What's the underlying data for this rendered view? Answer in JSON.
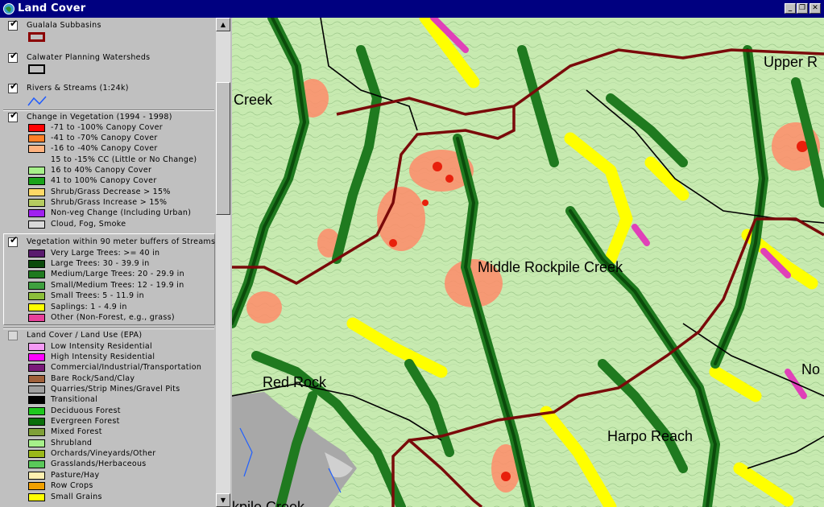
{
  "window": {
    "title": "Land Cover",
    "controls": {
      "minimize": "_",
      "restore": "❐",
      "close": "✕"
    }
  },
  "legend": {
    "layers": [
      {
        "name": "Gualala Subbasins",
        "checked": true,
        "swatch": "#8b0000"
      },
      {
        "name": "Calwater Planning Watersheds",
        "checked": true,
        "swatch": "#000000"
      },
      {
        "name": "Rivers & Streams (1:24k)",
        "checked": true,
        "swatch": "#1e5aff"
      },
      {
        "name": "Change in Vegetation (1994 - 1998)",
        "checked": true,
        "entries": [
          {
            "label": "-71 to -100% Canopy Cover",
            "color": "#ff0000"
          },
          {
            "label": "-41 to -70% Canopy Cover",
            "color": "#ff7f27"
          },
          {
            "label": "-16 to -40% Canopy Cover",
            "color": "#ffb27f"
          },
          {
            "label": "15 to -15% CC (Little or No Change)",
            "color": ""
          },
          {
            "label": "16 to 40% Canopy Cover",
            "color": "#a6f08a"
          },
          {
            "label": "41 to 100% Canopy Cover",
            "color": "#1aa31a"
          },
          {
            "label": "Shrub/Grass Decrease > 15%",
            "color": "#ffd966"
          },
          {
            "label": "Shrub/Grass Increase > 15%",
            "color": "#b5cc60"
          },
          {
            "label": "Non-veg Change (Including Urban)",
            "color": "#a020f0"
          },
          {
            "label": "Cloud, Fog, Smoke",
            "color": "#d9d9d9"
          }
        ]
      },
      {
        "name": "Vegetation within 90 meter buffers of Streams",
        "checked": true,
        "entries": [
          {
            "label": "Very Large Trees: >= 40  in",
            "color": "#5a1a6e"
          },
          {
            "label": "Large Trees: 30 - 39.9 in",
            "color": "#0b4a0b"
          },
          {
            "label": "Medium/Large Trees: 20 - 29.9 in",
            "color": "#1f7a1f"
          },
          {
            "label": "Small/Medium Trees: 12 - 19.9 in",
            "color": "#3fa03f"
          },
          {
            "label": "Small Trees: 5 - 11.9 in",
            "color": "#8cbf3a"
          },
          {
            "label": "Saplings: 1 - 4.9 in",
            "color": "#ffff00"
          },
          {
            "label": "Other (Non-Forest, e.g., grass)",
            "color": "#e8409a"
          }
        ]
      },
      {
        "name": "Land Cover / Land Use (EPA)",
        "checked": false,
        "entries": [
          {
            "label": "Low Intensity Residential",
            "color": "#f59af5"
          },
          {
            "label": "High Intensity Residential",
            "color": "#ff00ff"
          },
          {
            "label": "Commercial/Industrial/Transportation",
            "color": "#7a1a7a"
          },
          {
            "label": "Bare Rock/Sand/Clay",
            "color": "#a0603a"
          },
          {
            "label": "Quarries/Strip Mines/Gravel Pits",
            "color": "#a0a0a0"
          },
          {
            "label": "Transitional",
            "color": "#000000"
          },
          {
            "label": "Deciduous Forest",
            "color": "#1ec81e"
          },
          {
            "label": "Evergreen Forest",
            "color": "#0a6e0a"
          },
          {
            "label": "Mixed Forest",
            "color": "#7fa038"
          },
          {
            "label": "Shrubland",
            "color": "#a6f08a"
          },
          {
            "label": "Orchards/Vineyards/Other",
            "color": "#9ab81a"
          },
          {
            "label": "Grasslands/Herbaceous",
            "color": "#5ac85a"
          },
          {
            "label": "Pasture/Hay",
            "color": "#fff0b0"
          },
          {
            "label": "Row Crops",
            "color": "#f0a000"
          },
          {
            "label": "Small Grains",
            "color": "#ffff00"
          }
        ]
      }
    ]
  },
  "map": {
    "labels": [
      "Creek",
      "Upper R",
      "Middle Rockpile Creek",
      "Red Rock",
      "Harpo Reach",
      "No",
      "kpile Creek"
    ]
  }
}
